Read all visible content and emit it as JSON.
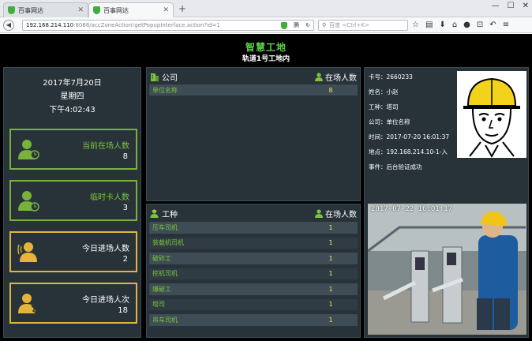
{
  "browser": {
    "tabs": [
      {
        "label": "百事网达",
        "active": false
      },
      {
        "label": "百事网达",
        "active": true
      }
    ],
    "url_host": "192.168.214.110",
    "url_path": ":8088/accZoneAction!getPopupInterface.action?id=1",
    "url_badge": "腾",
    "search_placeholder": "百度 <Ctrl+K>",
    "icons": [
      "back-icon",
      "forward-icon",
      "shield-icon",
      "reload-icon",
      "star-icon",
      "reader-icon",
      "download-icon",
      "home-icon",
      "chat-icon",
      "crop-icon",
      "undo-icon",
      "menu-icon"
    ]
  },
  "app": {
    "title": "智慧工地",
    "subtitle": "轨道1号工地内",
    "date": "2017年7月20日",
    "weekday": "星期四",
    "time": "下午4:02:43",
    "stats": [
      {
        "label": "当前在场人数",
        "value": "8",
        "color": "green",
        "icon": "person-clock-icon"
      },
      {
        "label": "临时卡人数",
        "value": "3",
        "color": "green",
        "icon": "person-card-icon"
      },
      {
        "label": "今日进场人数",
        "value": "2",
        "color": "yellow",
        "icon": "person-enter-icon"
      },
      {
        "label": "今日进场人次",
        "value": "18",
        "color": "yellow",
        "icon": "person-run-icon"
      }
    ],
    "company_table": {
      "header_left": "公司",
      "header_right": "在场人数",
      "rows": [
        {
          "name": "单位名称",
          "count": "8"
        }
      ]
    },
    "trade_table": {
      "header_left": "工种",
      "header_right": "在场人数",
      "rows": [
        {
          "name": "压车司机",
          "count": "1"
        },
        {
          "name": "装载机司机",
          "count": "1"
        },
        {
          "name": "破碎工",
          "count": "1"
        },
        {
          "name": "挖机司机",
          "count": "1"
        },
        {
          "name": "爆破工",
          "count": "1"
        },
        {
          "name": "塔司",
          "count": "1"
        },
        {
          "name": "吊车司机",
          "count": "1"
        }
      ]
    },
    "person": {
      "card": "卡号：2660233",
      "name": "姓名：小赵",
      "trade": "工种：塔司",
      "company": "公司：单位名称",
      "time": "时间：2017-07-20 16:01:37",
      "location": "地点：192.168.214.10-1-入",
      "event": "事件：后台验证成功"
    },
    "photo_timestamp": "2017-07-22 16:01:17",
    "colors": {
      "accent_green": "#7cc43f",
      "accent_yellow": "#e5b53a",
      "panel": "#283339",
      "background": "#000000"
    }
  }
}
